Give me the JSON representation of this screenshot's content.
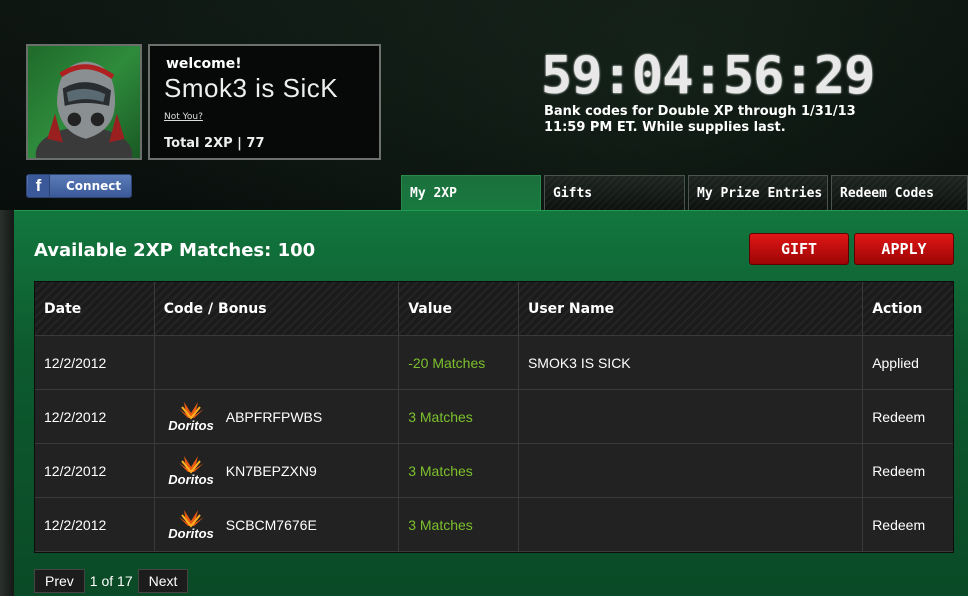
{
  "profile": {
    "welcome_label": "welcome!",
    "user_name": "Smok3 is SicK",
    "not_you_link": "Not You?",
    "total_xp": "Total 2XP | 77",
    "connect_label": "Connect",
    "fb_letter": "f"
  },
  "promo": {
    "countdown": "59:04:56:29",
    "text": "Bank codes for Double XP through 1/31/13 11:59 PM ET. While supplies last."
  },
  "tabs": [
    {
      "label": "My 2XP",
      "active": true
    },
    {
      "label": "Gifts",
      "active": false
    },
    {
      "label": "My Prize Entries",
      "active": false
    },
    {
      "label": "Redeem Codes",
      "active": false
    }
  ],
  "panel": {
    "title": "Available 2XP Matches: 100",
    "gift_label": "GIFT",
    "apply_label": "APPLY"
  },
  "table": {
    "headers": [
      "Date",
      "Code / Bonus",
      "Value",
      "User Name",
      "Action"
    ],
    "rows": [
      {
        "date": "12/2/2012",
        "code": "",
        "brand": "",
        "value": "-20 Matches",
        "user": "SMOK3 IS SICK",
        "action": "Applied"
      },
      {
        "date": "12/2/2012",
        "code": "ABPFRFPWBS",
        "brand": "Doritos",
        "value": "3 Matches",
        "user": "",
        "action": "Redeem"
      },
      {
        "date": "12/2/2012",
        "code": "KN7BEPZXN9",
        "brand": "Doritos",
        "value": "3 Matches",
        "user": "",
        "action": "Redeem"
      },
      {
        "date": "12/2/2012",
        "code": "SCBCM7676E",
        "brand": "Doritos",
        "value": "3 Matches",
        "user": "",
        "action": "Redeem"
      }
    ]
  },
  "pagination": {
    "prev_label": "Prev",
    "status": "1 of 17",
    "next_label": "Next"
  },
  "colors": {
    "accent_green": "#7cc02d",
    "button_red": "#c40a0a",
    "panel_green": "#12773d"
  }
}
